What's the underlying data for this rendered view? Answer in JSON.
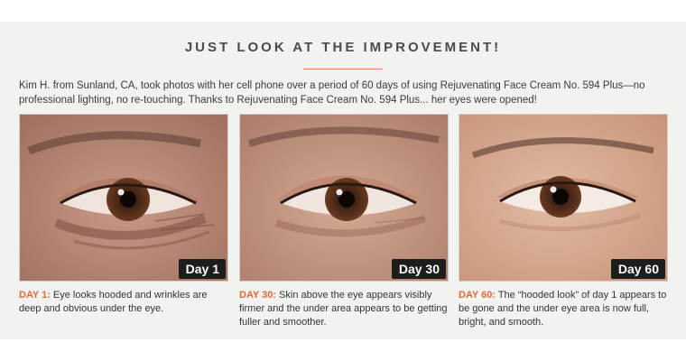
{
  "header": {
    "title": "JUST LOOK AT THE IMPROVEMENT!",
    "intro": "Kim H. from Sunland, CA, took photos with her cell phone over a period of 60 days of using Rejuvenating Face Cream No. 594 Plus—no professional lighting, no re-touching. Thanks to Rejuvenating Face Cream No. 594 Plus... her eyes were opened!"
  },
  "colors": {
    "accent": "#e36b33",
    "panel": "#f2f2f1",
    "tag_bg": "#1d1d1d"
  },
  "cards": [
    {
      "tag": "Day 1",
      "label": "DAY 1:",
      "text": " Eye looks hooded and wrinkles are deep and obvious under the eye."
    },
    {
      "tag": "Day 30",
      "label": "DAY 30:",
      "text": " Skin above the eye appears visibly firmer and the under area appears to be getting fuller and smoother."
    },
    {
      "tag": "Day 60",
      "label": "DAY 60:",
      "text": " The “hooded look” of day 1 appears to be gone and the under eye area is now full, bright, and smooth."
    }
  ]
}
